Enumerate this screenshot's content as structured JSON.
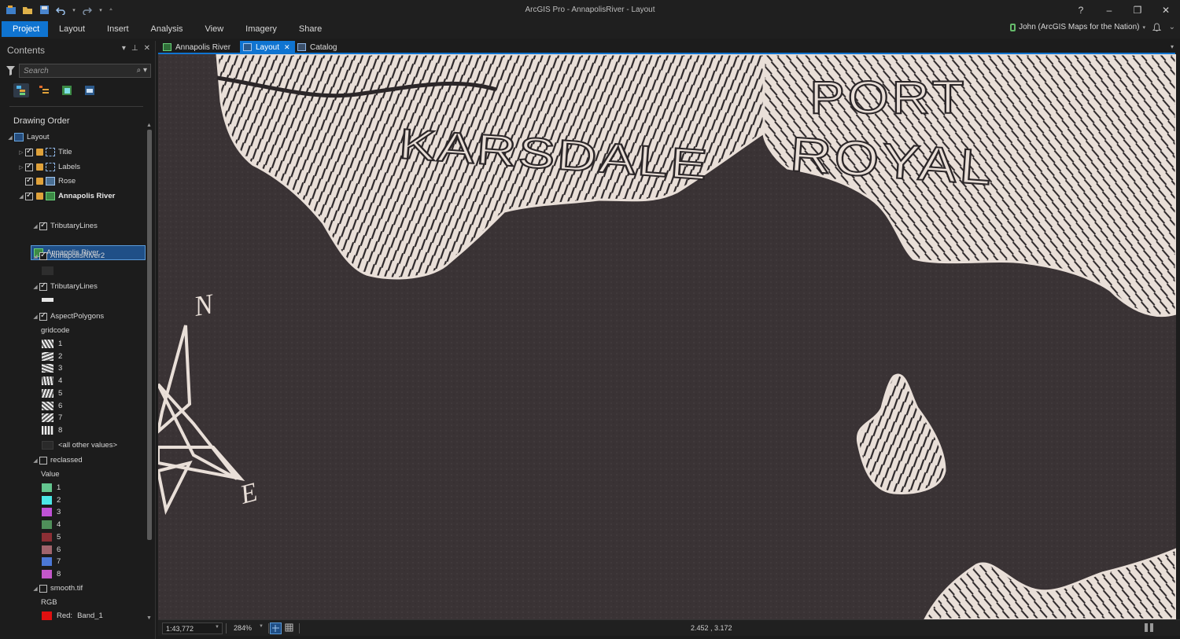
{
  "window": {
    "title": "ArcGIS Pro - AnnapolisRiver - Layout"
  },
  "title_controls": {
    "help": "?",
    "minimize": "–",
    "restore": "❐",
    "close": "✕"
  },
  "ribbon": {
    "tabs": [
      "Project",
      "Layout",
      "Insert",
      "Analysis",
      "View",
      "Imagery",
      "Share"
    ],
    "user": "John (ArcGIS Maps for the Nation)",
    "bell_icon": "🔔",
    "dropdown": "⌄"
  },
  "contents": {
    "title": "Contents",
    "search_placeholder": "Search",
    "section": "Drawing Order",
    "layout_label": "Layout",
    "items": {
      "title": "Title",
      "labels": "Labels",
      "rose": "Rose",
      "annapolis_map": "Annapolis River",
      "annapolis_frame": "Annapolis River",
      "tributary1": "TributaryLines",
      "annapolis2": "AnnapolisRiver2",
      "tributary2": "TributaryLines",
      "aspect": "AspectPolygons",
      "gridcode": "gridcode",
      "aspect_values": [
        "1",
        "2",
        "3",
        "4",
        "5",
        "6",
        "7",
        "8"
      ],
      "all_other": "<all other values>",
      "reclassed": "reclassed",
      "value_heading": "Value",
      "reclassed_values": [
        "1",
        "2",
        "3",
        "4",
        "5",
        "6",
        "7",
        "8"
      ],
      "reclassed_colors": [
        "#63c58f",
        "#4be6e6",
        "#c052d6",
        "#4f8f5a",
        "#8c2f35",
        "#a0646c",
        "#4b78d6",
        "#c357c9"
      ],
      "smooth": "smooth.tif",
      "rgb": "RGB",
      "red_label": "Red:",
      "red_band": "Band_1",
      "red_color": "#e01010"
    }
  },
  "doc_tabs": {
    "map_tab": "Annapolis River",
    "layout_tab": "Layout",
    "catalog_tab": "Catalog",
    "close": "✕"
  },
  "map": {
    "karsdale": "KARSDALE",
    "port": "PORT",
    "royal": "ROYAL",
    "north": "N",
    "east": "E",
    "land_color": "#e9dfd8",
    "water_color": "#3a3335"
  },
  "status": {
    "scale": "1:43,772",
    "zoom": "284%",
    "coords": "2.452 , 3.172"
  }
}
